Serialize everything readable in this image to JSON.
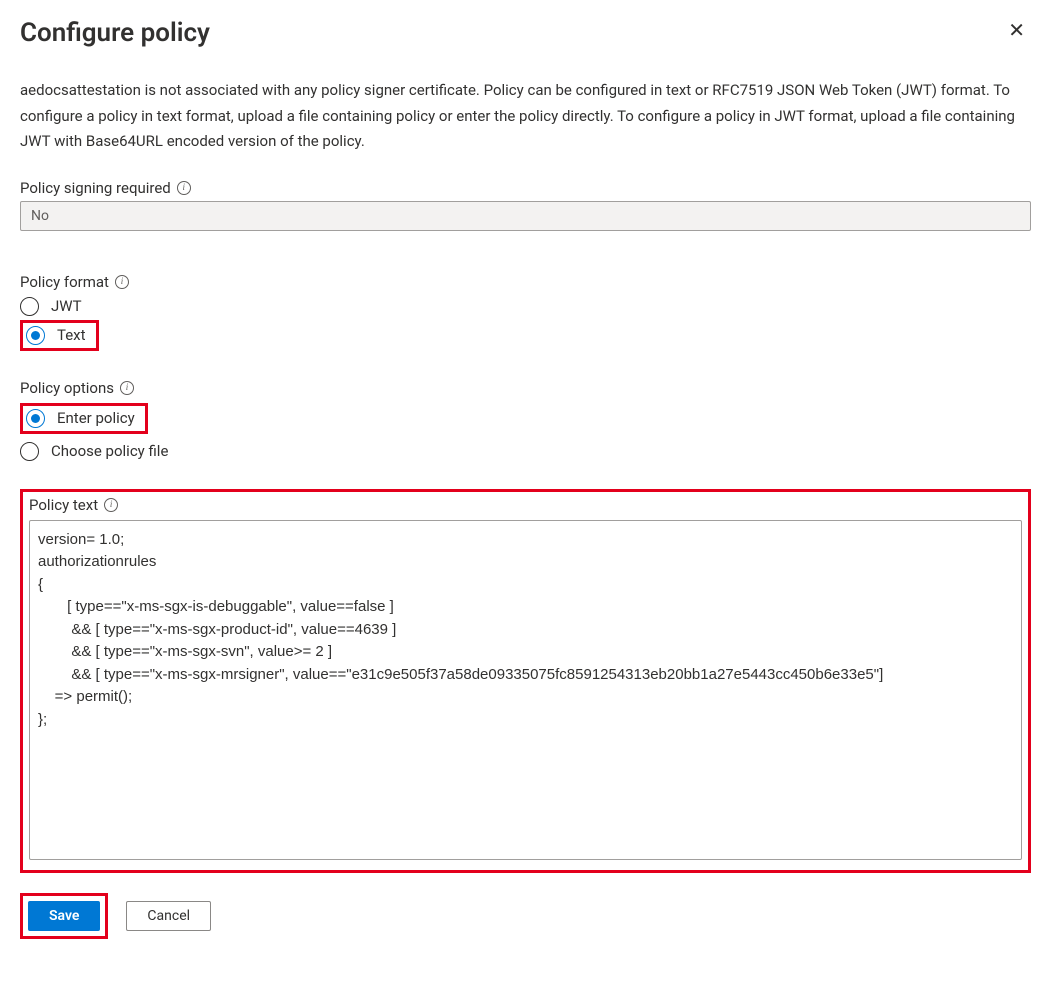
{
  "header": {
    "title": "Configure policy",
    "close_icon": "✕"
  },
  "description": "aedocsattestation is not associated with any policy signer certificate. Policy can be configured in text or RFC7519 JSON Web Token (JWT) format. To configure a policy in text format, upload a file containing policy or enter the policy directly. To configure a policy in JWT format, upload a file containing JWT with Base64URL encoded version of the policy.",
  "fields": {
    "signing_required": {
      "label": "Policy signing required",
      "value": "No"
    },
    "policy_format": {
      "label": "Policy format",
      "options": [
        {
          "label": "JWT",
          "checked": false
        },
        {
          "label": "Text",
          "checked": true
        }
      ]
    },
    "policy_options": {
      "label": "Policy options",
      "options": [
        {
          "label": "Enter policy",
          "checked": true
        },
        {
          "label": "Choose policy file",
          "checked": false
        }
      ]
    },
    "policy_text": {
      "label": "Policy text",
      "value": "version= 1.0;\nauthorizationrules\n{\n       [ type==\"x-ms-sgx-is-debuggable\", value==false ]\n        && [ type==\"x-ms-sgx-product-id\", value==4639 ]\n        && [ type==\"x-ms-sgx-svn\", value>= 2 ]\n        && [ type==\"x-ms-sgx-mrsigner\", value==\"e31c9e505f37a58de09335075fc8591254313eb20bb1a27e5443cc450b6e33e5\"]\n    => permit();\n};"
    }
  },
  "buttons": {
    "save": "Save",
    "cancel": "Cancel"
  },
  "icons": {
    "info": "i"
  }
}
